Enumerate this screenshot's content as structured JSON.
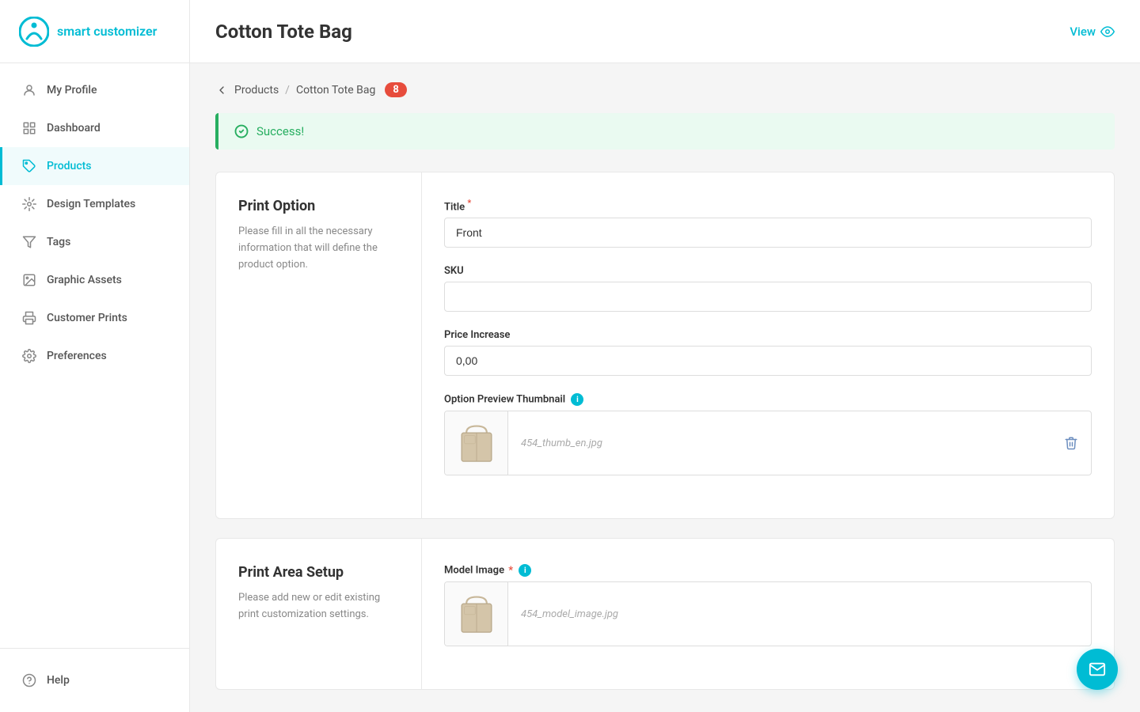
{
  "brand": {
    "name": "smart customizer",
    "logoColor": "#00bcd4"
  },
  "sidebar": {
    "items": [
      {
        "id": "my-profile",
        "label": "My Profile",
        "active": false,
        "icon": "user-icon"
      },
      {
        "id": "dashboard",
        "label": "Dashboard",
        "active": false,
        "icon": "dashboard-icon"
      },
      {
        "id": "products",
        "label": "Products",
        "active": true,
        "icon": "tag-icon"
      },
      {
        "id": "design-templates",
        "label": "Design Templates",
        "active": false,
        "icon": "design-icon"
      },
      {
        "id": "tags",
        "label": "Tags",
        "active": false,
        "icon": "filter-icon"
      },
      {
        "id": "graphic-assets",
        "label": "Graphic Assets",
        "active": false,
        "icon": "graphic-icon"
      },
      {
        "id": "customer-prints",
        "label": "Customer Prints",
        "active": false,
        "icon": "print-icon"
      },
      {
        "id": "preferences",
        "label": "Preferences",
        "active": false,
        "icon": "gear-icon"
      }
    ],
    "bottomItems": [
      {
        "id": "help",
        "label": "Help",
        "icon": "help-icon"
      }
    ]
  },
  "header": {
    "title": "Cotton Tote Bag",
    "viewLabel": "View"
  },
  "breadcrumb": {
    "backArrow": "←",
    "productsLabel": "Products",
    "separator": "/",
    "currentLabel": "Cotton Tote Bag",
    "badgeCount": "8"
  },
  "alert": {
    "message": "Success!"
  },
  "printOption": {
    "sectionTitle": "Print Option",
    "sectionDesc": "Please fill in all the necessary information that will define the product option.",
    "titleLabel": "Title",
    "titleRequired": true,
    "titleValue": "Front",
    "titlePlaceholder": "",
    "skuLabel": "SKU",
    "skuValue": "",
    "skuPlaceholder": "",
    "priceIncreaseLabel": "Price Increase",
    "priceValue": "0,00",
    "thumbnailLabel": "Option Preview Thumbnail",
    "thumbnailFilename": "454_thumb_en.jpg",
    "infoTooltip": "i"
  },
  "printAreaSetup": {
    "sectionTitle": "Print Area Setup",
    "sectionDesc": "Please add new or edit existing print customization settings.",
    "modelImageLabel": "Model Image",
    "modelImageFilename": "454_model_image.jpg",
    "infoTooltip": "i"
  },
  "emailFab": {
    "label": "✉"
  }
}
